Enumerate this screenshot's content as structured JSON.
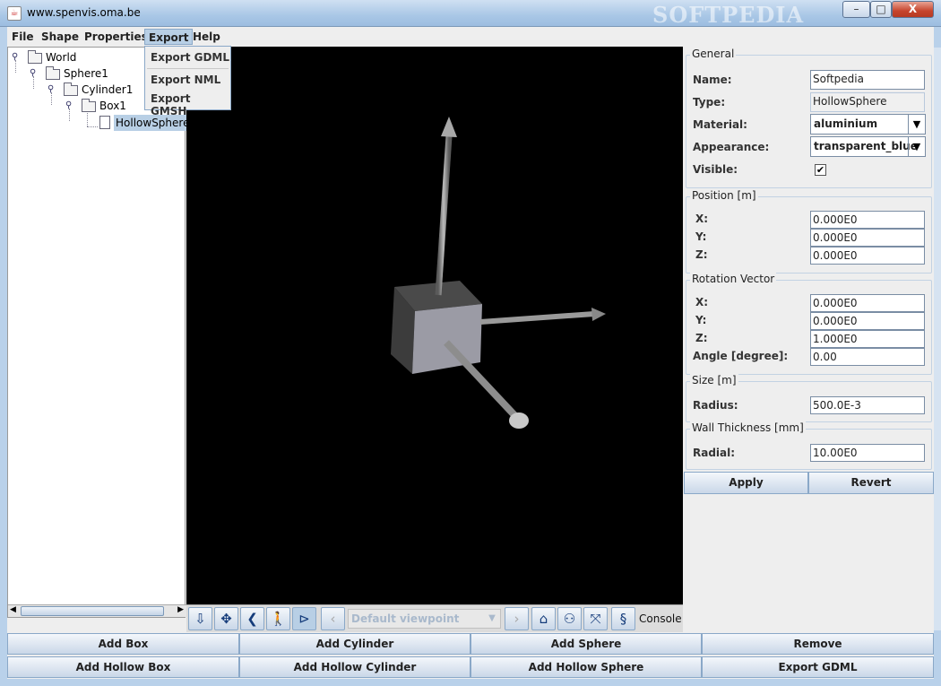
{
  "window": {
    "title": "www.spenvis.oma.be",
    "watermark": "SOFTPEDIA",
    "minimize": "–",
    "maximize": "□",
    "close": "X"
  },
  "menu": {
    "file": "File",
    "shape": "Shape",
    "properties": "Properties",
    "export": "Export",
    "help": "Help"
  },
  "export_menu": {
    "gdml": "Export GDML",
    "nml": "Export NML",
    "gmsh": "Export GMSH"
  },
  "tree": {
    "world": "World",
    "sphere1": "Sphere1",
    "cylinder1": "Cylinder1",
    "box1": "Box1",
    "hollowsphere": "HollowSphere"
  },
  "toolbar3d": {
    "viewpoint": "Default viewpoint",
    "console": "Console"
  },
  "props": {
    "general": {
      "title": "General",
      "name_label": "Name:",
      "name_value": "Softpedia",
      "type_label": "Type:",
      "type_value": "HollowSphere",
      "material_label": "Material:",
      "material_value": "aluminium",
      "appearance_label": "Appearance:",
      "appearance_value": "transparent_blue",
      "visible_label": "Visible:",
      "visible_mark": "✔"
    },
    "position": {
      "title": "Position [m]",
      "x_label": "X:",
      "x": "0.000E0",
      "y_label": "Y:",
      "y": "0.000E0",
      "z_label": "Z:",
      "z": "0.000E0"
    },
    "rotation": {
      "title": "Rotation Vector",
      "x_label": "X:",
      "x": "0.000E0",
      "y_label": "Y:",
      "y": "0.000E0",
      "z_label": "Z:",
      "z": "1.000E0",
      "angle_label": "Angle [degree]:",
      "angle": "0.00"
    },
    "size": {
      "title": "Size [m]",
      "radius_label": "Radius:",
      "radius": "500.0E-3"
    },
    "wall": {
      "title": "Wall Thickness [mm]",
      "radial_label": "Radial:",
      "radial": "10.00E0"
    },
    "apply": "Apply",
    "revert": "Revert"
  },
  "buttons": {
    "add_box": "Add Box",
    "add_cylinder": "Add Cylinder",
    "add_sphere": "Add Sphere",
    "remove": "Remove",
    "add_hollow_box": "Add Hollow Box",
    "add_hollow_cylinder": "Add Hollow Cylinder",
    "add_hollow_sphere": "Add Hollow Sphere",
    "export_gdml": "Export GDML"
  },
  "icons": [
    "java-app-icon",
    "folder-icon",
    "document-icon",
    "rotate-icon",
    "pan-icon",
    "previous-icon",
    "walk-icon",
    "fly-icon",
    "home-icon",
    "binoculars-icon",
    "fit-view-icon",
    "console-icon"
  ]
}
